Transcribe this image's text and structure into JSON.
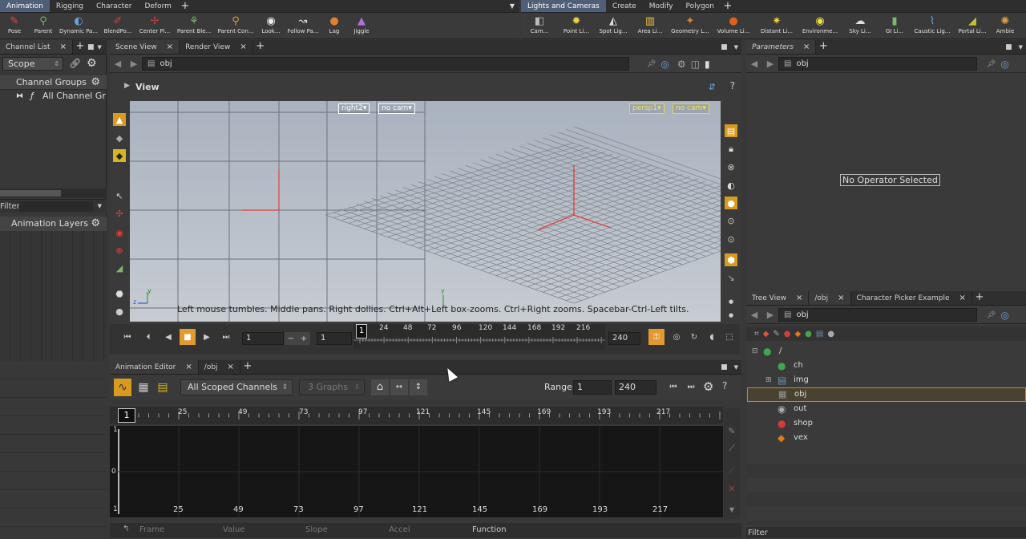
{
  "shelf_left": {
    "tabs": [
      "Animation",
      "Rigging",
      "Character",
      "Deform"
    ],
    "active_tab": "Animation",
    "tools": [
      "Pose",
      "Parent",
      "Dynamic Pa...",
      "BlendPo...",
      "Center Pi...",
      "Parent Ble...",
      "Parent Con...",
      "Look...",
      "Follow Pa...",
      "Lag",
      "Jiggle"
    ]
  },
  "shelf_right": {
    "tabs": [
      "Lights and Cameras",
      "Create",
      "Modify",
      "Polygon"
    ],
    "active_tab": "Lights and Cameras",
    "tools": [
      "Cam...",
      "Point Li...",
      "Spot Lig...",
      "Area Li...",
      "Geometry L...",
      "Volume Li...",
      "Distant Li...",
      "Environme...",
      "Sky Li...",
      "GI Li...",
      "Caustic Lig...",
      "Portal Li...",
      "Ambie"
    ]
  },
  "left_panel": {
    "tab": "Channel List",
    "scope_label": "Scope",
    "channel_groups": "Channel Groups",
    "all_channels": "All Channel Gr",
    "filter_label": "Filter",
    "animation_layers": "Animation Layers"
  },
  "scene_panel": {
    "tabs": [
      "Scene View",
      "Render View"
    ],
    "path": "obj",
    "view_title": "View",
    "ortho_cam": "right2",
    "ortho_cam_lookthrough": "no cam",
    "persp_cam": "persp1",
    "persp_cam_lookthrough": "no cam",
    "axis_x": "x",
    "axis_y": "y",
    "axis_z": "z",
    "help_text": "Left mouse tumbles. Middle pans. Right dollies. Ctrl+Alt+Left box-zooms. Ctrl+Right zooms. Spacebar-Ctrl-Left tilts."
  },
  "timeline": {
    "current_frame": "1",
    "start_frame": "1",
    "range_start": "1",
    "end_frame": "240",
    "tick_labels": [
      "24",
      "48",
      "72",
      "96",
      "120",
      "144",
      "168",
      "192",
      "216"
    ],
    "frame_marker": "1"
  },
  "anim_editor": {
    "tabs": [
      "Animation Editor",
      "/obj"
    ],
    "channel_scope": "All Scoped Channels",
    "graphs": "3 Graphs",
    "range_label": "Range",
    "range_start": "1",
    "range_end": "240",
    "ruler_labels": [
      "25",
      "49",
      "73",
      "97",
      "121",
      "145",
      "169",
      "193",
      "217"
    ],
    "ruler_marker": "1",
    "y_labels": [
      "1",
      "0",
      "1"
    ],
    "fields": [
      "Frame",
      "Value",
      "Slope",
      "Accel",
      "Function"
    ]
  },
  "parameters": {
    "tab": "Parameters",
    "path": "obj",
    "message": "No Operator Selected"
  },
  "tree_panel": {
    "tabs": [
      "Tree View",
      "/obj",
      "Character Picker Example"
    ],
    "path": "obj",
    "root": "/",
    "items": [
      {
        "label": "ch",
        "color": "#3fa84f"
      },
      {
        "label": "img",
        "color": "#6a8fb5"
      },
      {
        "label": "obj",
        "color": "#8a8a8a"
      },
      {
        "label": "out",
        "color": "#aaaaaa"
      },
      {
        "label": "shop",
        "color": "#d83a3a"
      },
      {
        "label": "vex",
        "color": "#e07a1a"
      }
    ],
    "filter_label": "Filter"
  }
}
